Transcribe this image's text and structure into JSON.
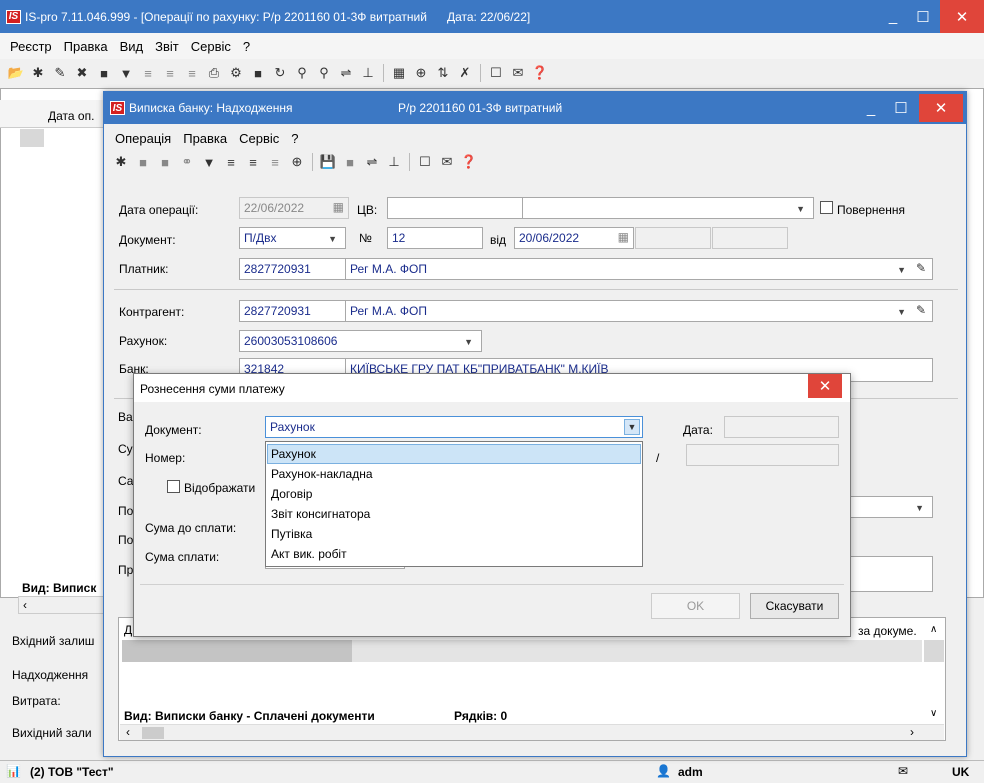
{
  "main_window": {
    "title": "IS-pro 7.11.046.999 - [Операції по рахунку: Р/р 2201160 01-3Ф витратний      Дата: 22/06/22]",
    "logo": "IS",
    "menu": [
      "Реєстр",
      "Правка",
      "Вид",
      "Звіт",
      "Сервіс",
      "?"
    ],
    "grid_header": "Дата оп.",
    "footer_label": "Вид: Виписк",
    "left_labels": [
      "Вхідний залиш",
      "Надходження",
      "Витрата:",
      "Вихідний зали"
    ],
    "status": {
      "company": "(2) ТОВ \"Тест\"",
      "user": "adm",
      "lang": "UK"
    }
  },
  "bank_window": {
    "title": "Виписка банку: Надходження",
    "account": "Р/р 2201160 01-3Ф витратний",
    "menu": [
      "Операція",
      "Правка",
      "Сервіс",
      "?"
    ],
    "fields": {
      "op_date_label": "Дата операції:",
      "op_date": "22/06/2022",
      "cv_label": "ЦВ:",
      "return_label": "Повернення",
      "doc_label": "Документ:",
      "doc_value": "П/Двх",
      "num_label": "№",
      "num_value": "12",
      "from_label": "від",
      "from_date": "20/06/2022",
      "payer_label": "Платник:",
      "payer_code": "2827720931",
      "payer_name": "Рег М.А. ФОП",
      "contr_label": "Контрагент:",
      "contr_code": "2827720931",
      "contr_name": "Рег М.А. ФОП",
      "account_label": "Рахунок:",
      "account_value": "26003053108606",
      "bank_label": "Банк:",
      "bank_code": "321842",
      "bank_name": "КИЇВСЬКЕ ГРУ ПАТ КБ\"ПРИВАТБАНК\" М.КИЇВ"
    },
    "left_partial": [
      "Ва",
      "Су",
      "Са",
      "По",
      "По",
      "Пр"
    ],
    "grid_col_partial": "Д",
    "grid_col_right": "за докуме.",
    "footer": "Вид: Виписки банку - Сплачені документи",
    "rows_label": "Рядків: 0"
  },
  "dialog": {
    "title": "Рознесення суми платежу",
    "doc_label": "Документ:",
    "doc_value": "Рахунок",
    "date_label": "Дата:",
    "num_label": "Номер:",
    "slash": "/",
    "show_label": "Відображати",
    "sum_due_label": "Сума до сплати:",
    "sum_pay_label": "Сума сплати:",
    "ok": "OK",
    "cancel": "Скасувати",
    "options": [
      "Рахунок",
      "Рахунок-накладна",
      "Договір",
      "Звіт консигнатора",
      "Путівка",
      "Акт вик. робіт"
    ]
  },
  "colors": {
    "titlebar": "#3c78c4",
    "close": "#e0453a",
    "value_text": "#1a2c8c"
  }
}
